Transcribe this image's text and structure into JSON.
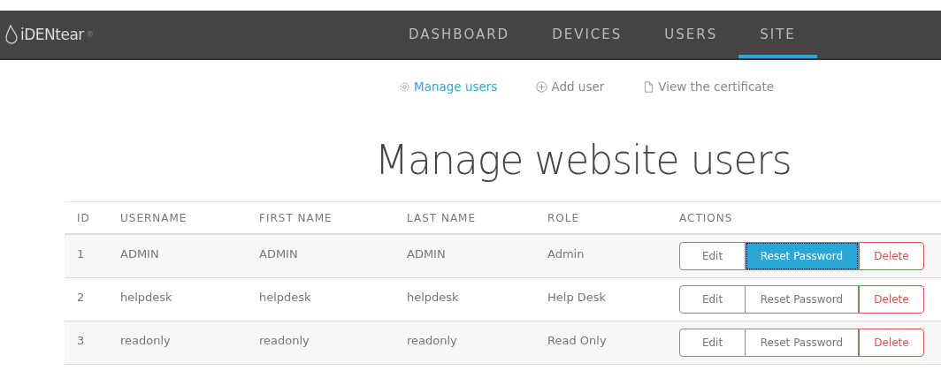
{
  "brand": {
    "name": "iDENtear",
    "mark": "®"
  },
  "nav": [
    {
      "label": "DASHBOARD",
      "selected": false
    },
    {
      "label": "DEVICES",
      "selected": false
    },
    {
      "label": "USERS",
      "selected": false
    },
    {
      "label": "SITE",
      "selected": true
    }
  ],
  "subnav": [
    {
      "label": "Manage users",
      "kind": "gear",
      "selected": true
    },
    {
      "label": "Add user",
      "kind": "plus",
      "selected": false
    },
    {
      "label": "View the certificate",
      "kind": "file",
      "selected": false
    }
  ],
  "heading": "Manage website users",
  "table": {
    "columns": [
      "ID",
      "USERNAME",
      "FIRST NAME",
      "LAST NAME",
      "ROLE",
      "ACTIONS"
    ],
    "rows": [
      {
        "cells": [
          "1",
          "ADMIN",
          "ADMIN",
          "ADMIN",
          "Admin"
        ],
        "actions": [
          {
            "label": "Edit",
            "kind": "default",
            "highlighted": false
          },
          {
            "label": "Reset Password",
            "kind": "default",
            "highlighted": true
          },
          {
            "label": "Delete",
            "kind": "danger",
            "highlighted": false
          }
        ]
      },
      {
        "cells": [
          "2",
          "helpdesk",
          "helpdesk",
          "helpdesk",
          "Help Desk"
        ],
        "actions": [
          {
            "label": "Edit",
            "kind": "default",
            "highlighted": false
          },
          {
            "label": "Reset Password",
            "kind": "default",
            "highlighted": false
          },
          {
            "label": "Delete",
            "kind": "danger",
            "highlighted": false
          }
        ]
      },
      {
        "cells": [
          "3",
          "readonly",
          "readonly",
          "readonly",
          "Read Only"
        ],
        "actions": [
          {
            "label": "Edit",
            "kind": "default",
            "highlighted": false
          },
          {
            "label": "Reset Password",
            "kind": "default",
            "highlighted": false
          },
          {
            "label": "Delete",
            "kind": "danger",
            "highlighted": false
          }
        ]
      }
    ]
  }
}
